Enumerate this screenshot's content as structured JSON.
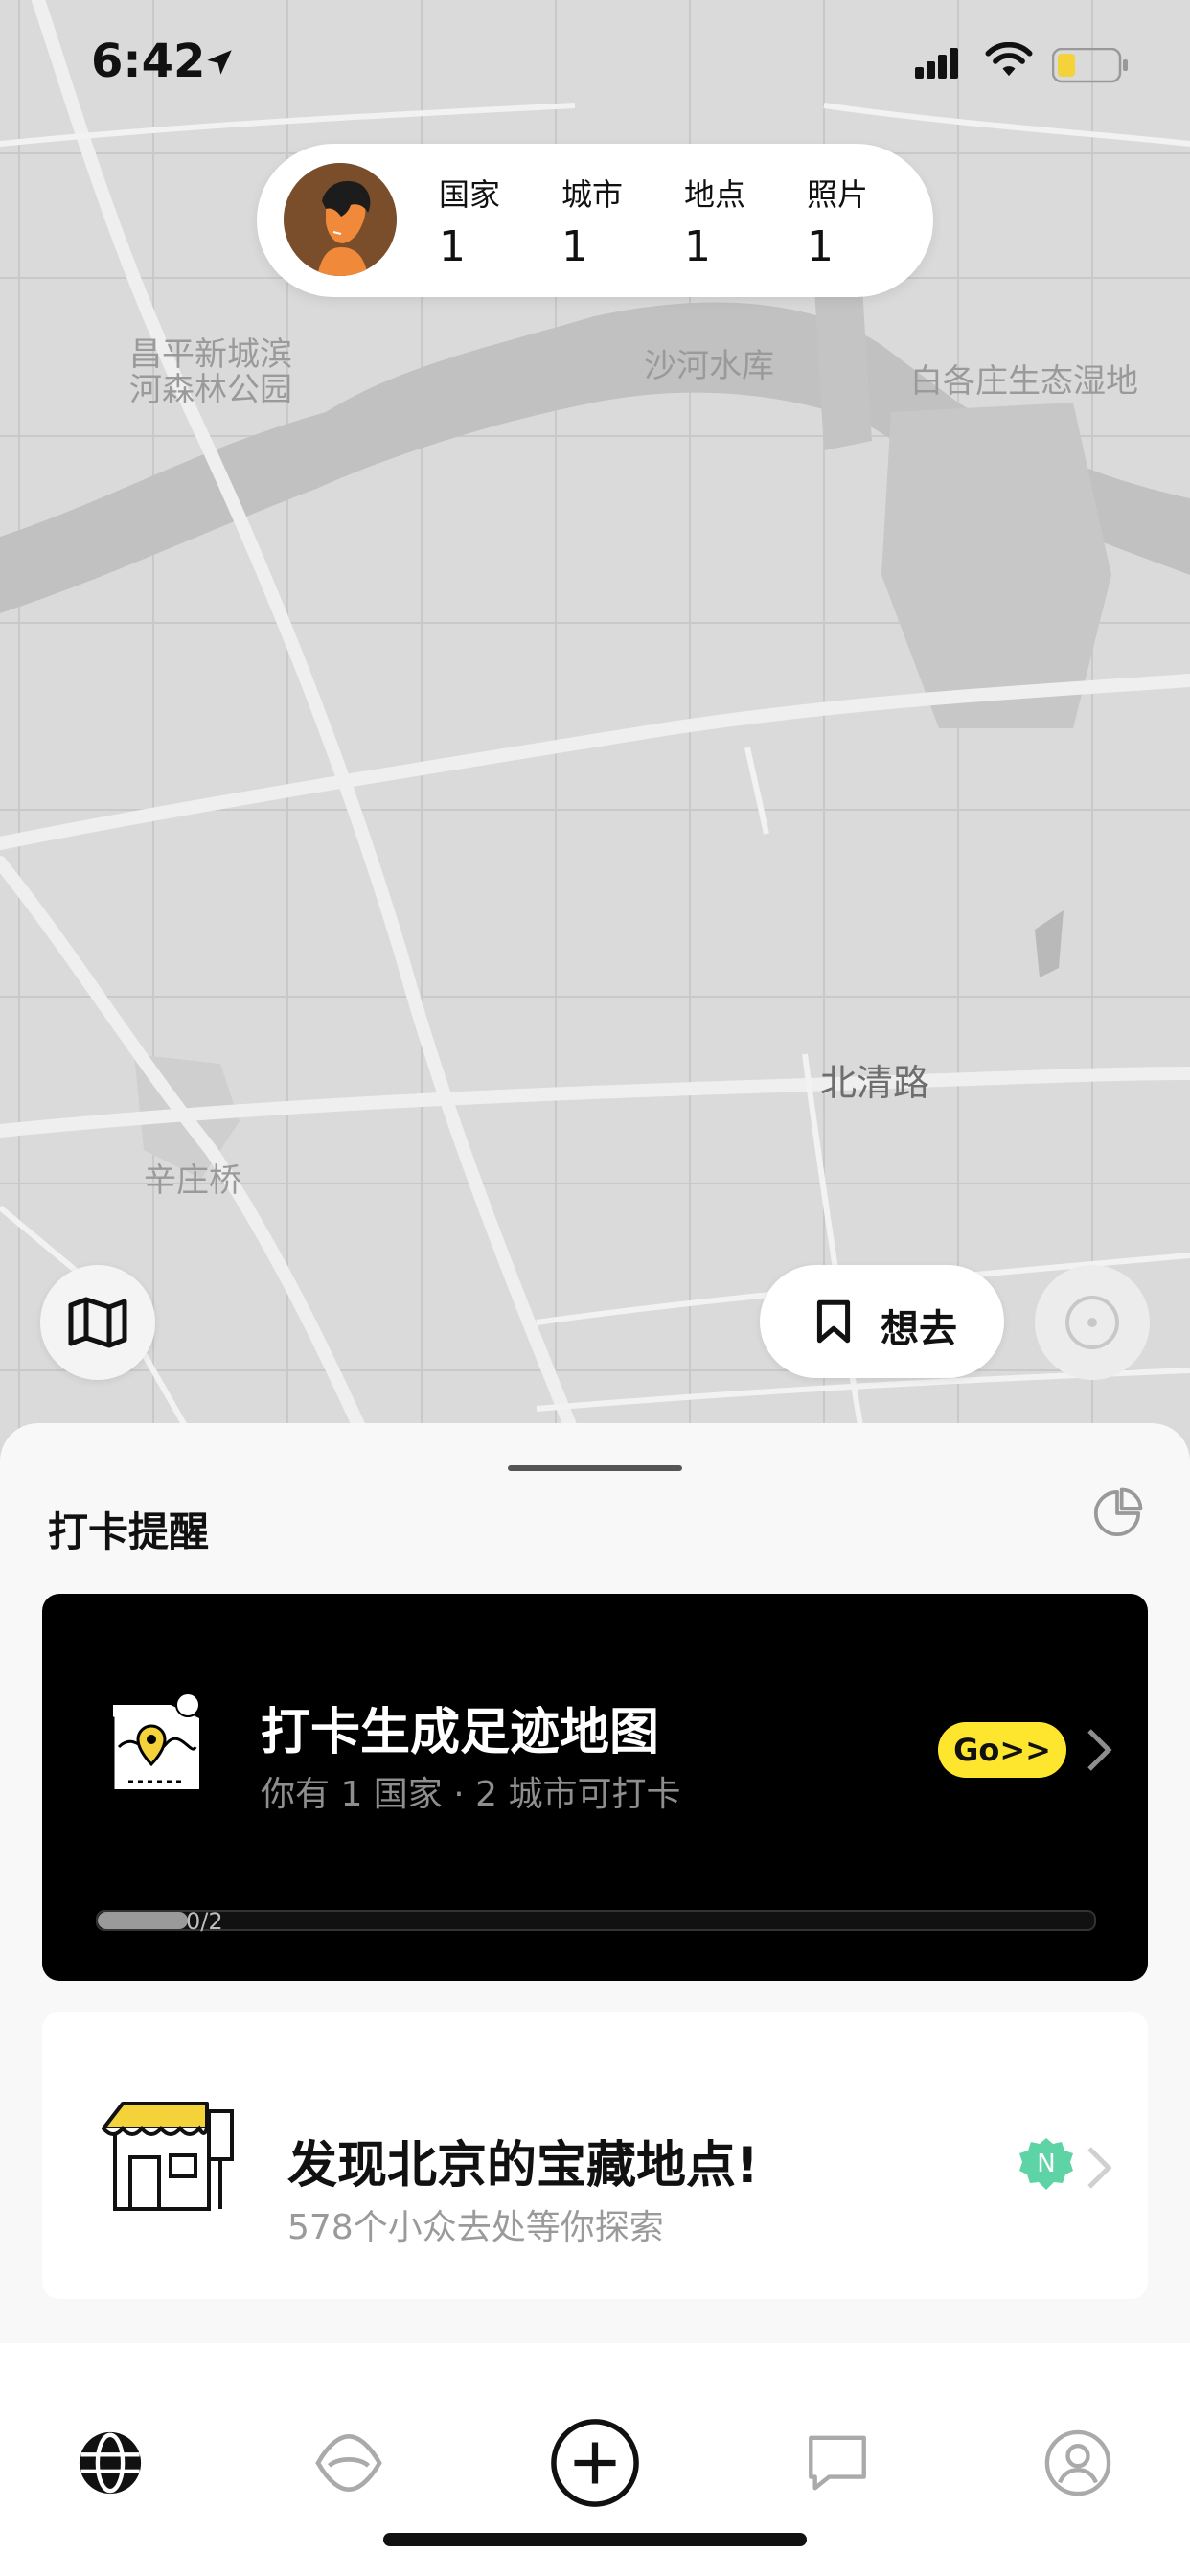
{
  "status_bar": {
    "time": "6:42"
  },
  "stats": [
    {
      "label": "国家",
      "value": "1"
    },
    {
      "label": "城市",
      "value": "1"
    },
    {
      "label": "地点",
      "value": "1"
    },
    {
      "label": "照片",
      "value": "1"
    }
  ],
  "map": {
    "labels": {
      "park": "昌平新城滨\n河森林公园",
      "reservoir": "沙河水库",
      "wetland": "白各庄生态湿地",
      "road": "北清路",
      "bridge": "辛庄桥"
    }
  },
  "buttons": {
    "want_to_go": "想去"
  },
  "sheet": {
    "title": "打卡提醒",
    "checkin_card": {
      "title": "打卡生成足迹地图",
      "subtitle": "你有 1 国家 · 2 城市可打卡",
      "go_label": "Go>>",
      "progress_text": "0/2",
      "progress_fraction": 0
    },
    "discover_card": {
      "title": "发现北京的宝藏地点!",
      "subtitle": "578个小众去处等你探索",
      "badge": "N"
    }
  },
  "tabs": [
    "globe-tab",
    "explore-tab",
    "add-tab",
    "messages-tab",
    "profile-tab"
  ],
  "colors": {
    "accent_yellow": "#ffe62e",
    "badge_green": "#5ed3a6",
    "card_dark": "#000000"
  }
}
